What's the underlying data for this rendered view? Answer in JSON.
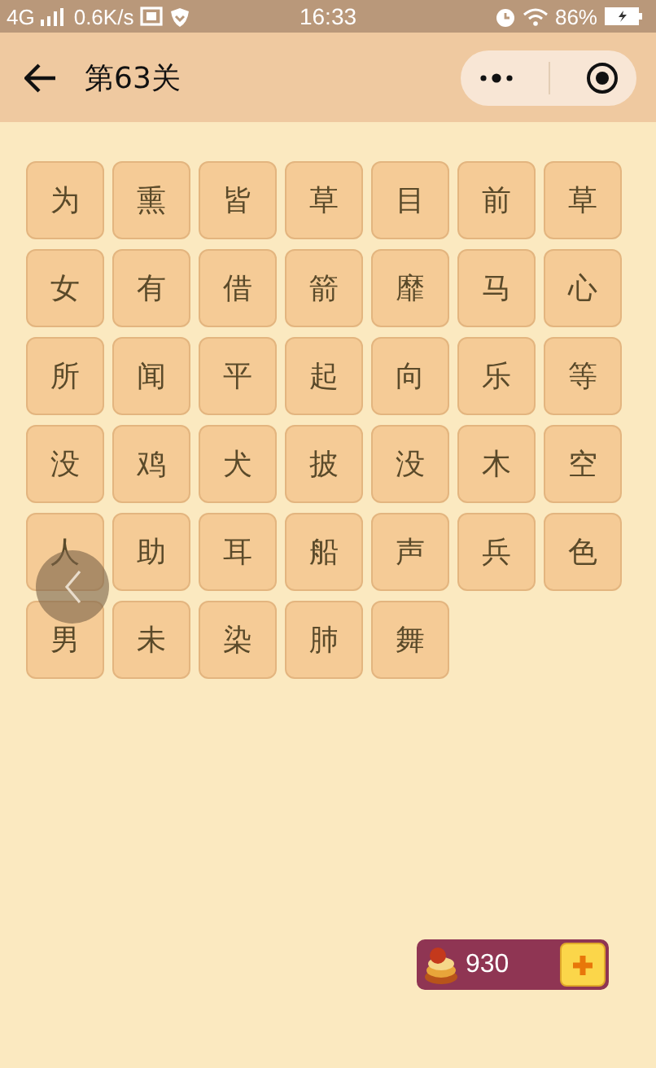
{
  "status_bar": {
    "network": "4G",
    "speed": "0.6K/s",
    "time": "16:33",
    "battery": "86%"
  },
  "header": {
    "title": "第63关"
  },
  "tiles": [
    "为",
    "熏",
    "皆",
    "草",
    "目",
    "前",
    "草",
    "女",
    "有",
    "借",
    "箭",
    "靡",
    "马",
    "心",
    "所",
    "闻",
    "平",
    "起",
    "向",
    "乐",
    "等",
    "没",
    "鸡",
    "犬",
    "披",
    "没",
    "木",
    "空",
    "人",
    "助",
    "耳",
    "船",
    "声",
    "兵",
    "色",
    "男",
    "未",
    "染",
    "肺",
    "舞"
  ],
  "coins": {
    "count": "930"
  }
}
